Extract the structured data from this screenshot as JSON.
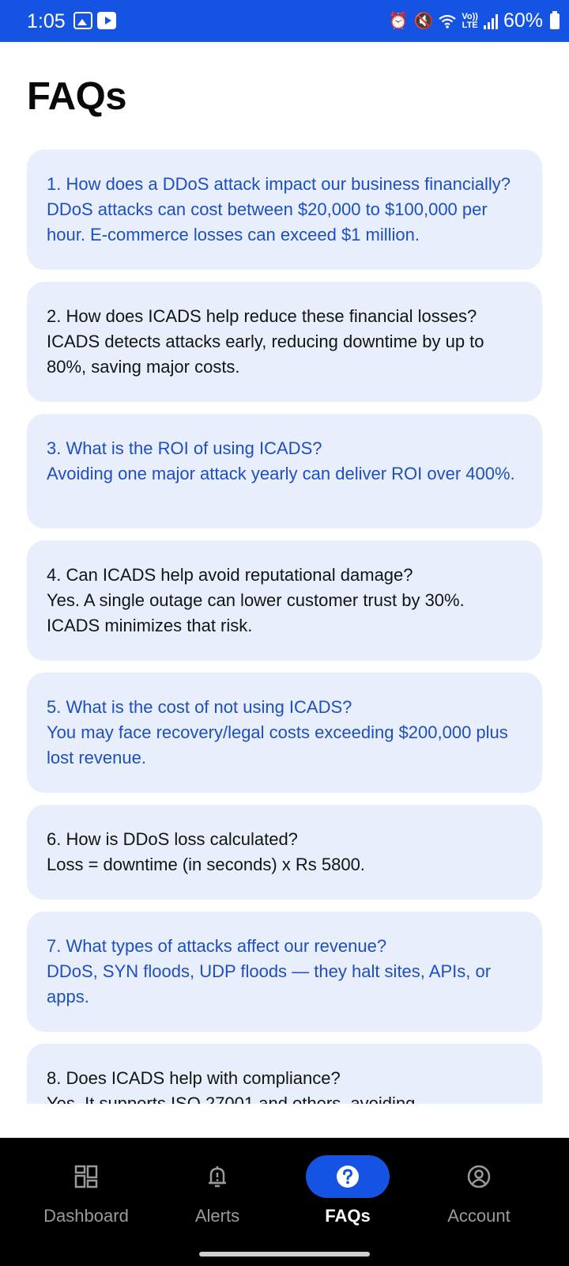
{
  "status_bar": {
    "time": "1:05",
    "left_icons": [
      "gallery-icon",
      "youtube-icon"
    ],
    "right_icons": [
      "alarm-icon",
      "mute-icon",
      "wifi-icon",
      "volte-icon",
      "signal-icon",
      "battery-icon"
    ],
    "volte_label_top": "Vo))",
    "volte_label_bottom": "LTE",
    "battery": "60%",
    "background_color": "#1553e3"
  },
  "page": {
    "title": "FAQs"
  },
  "faqs": [
    {
      "question": "1. How does a DDoS attack impact our business financially?",
      "answer": "DDoS attacks can cost between $20,000 to $100,000 per hour. E-commerce losses can exceed $1 million.",
      "color": "#1d4fbf"
    },
    {
      "question": "2. How does ICADS help reduce these financial losses?",
      "answer": "ICADS detects attacks early, reducing downtime by up to 80%, saving major costs.",
      "color": "#141414"
    },
    {
      "question": "3. What is the ROI of using ICADS?",
      "answer": "Avoiding one major attack yearly can deliver ROI over 400%.",
      "color": "#1d4fbf"
    },
    {
      "question": "4. Can ICADS help avoid reputational damage?",
      "answer": "Yes. A single outage can lower customer trust by 30%. ICADS minimizes that risk.",
      "color": "#141414"
    },
    {
      "question": "5. What is the cost of not using ICADS?",
      "answer": "You may face recovery/legal costs exceeding $200,000 plus lost revenue.",
      "color": "#1d4fbf"
    },
    {
      "question": "6. How is DDoS loss calculated?",
      "answer": "Loss = downtime (in seconds) x Rs 5800.",
      "color": "#141414"
    },
    {
      "question": "7. What types of attacks affect our revenue?",
      "answer": "DDoS, SYN floods, UDP floods — they halt sites, APIs, or apps.",
      "color": "#1d4fbf"
    },
    {
      "question": "8. Does ICADS help with compliance?",
      "answer": "Yes. It supports ISO 27001 and others, avoiding",
      "color": "#141414"
    }
  ],
  "bottom_nav": {
    "items": [
      {
        "label": "Dashboard",
        "icon": "dashboard-icon",
        "active": false
      },
      {
        "label": "Alerts",
        "icon": "bell-alert-icon",
        "active": false
      },
      {
        "label": "FAQs",
        "icon": "help-circle-icon",
        "active": true
      },
      {
        "label": "Account",
        "icon": "account-icon",
        "active": false
      }
    ],
    "active_color": "#1553e3"
  }
}
